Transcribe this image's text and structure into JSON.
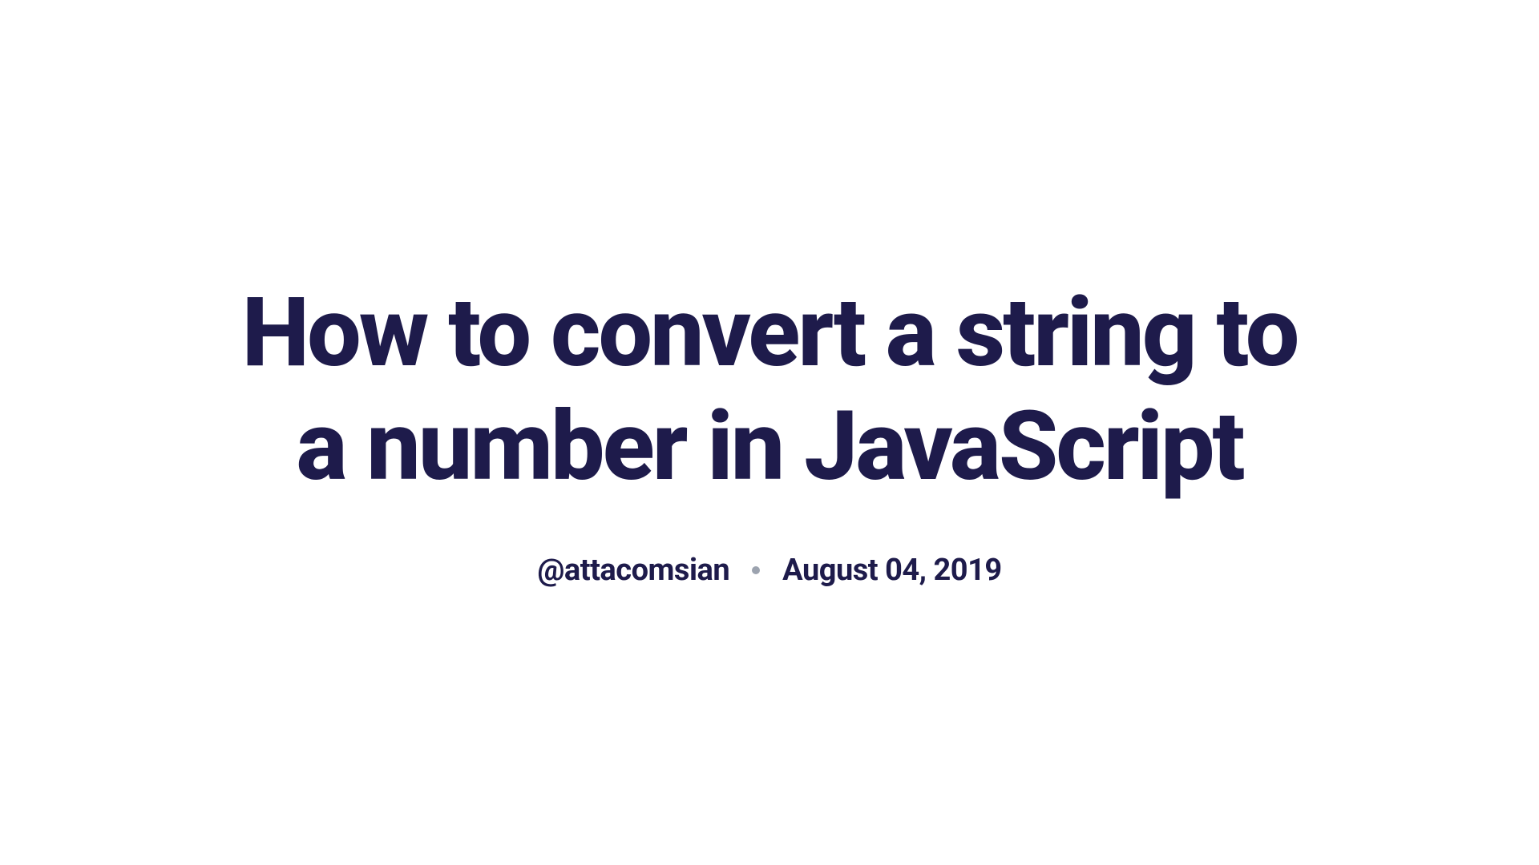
{
  "article": {
    "title": "How to convert a string to a number in JavaScript",
    "author": "@attacomsian",
    "date": "August 04, 2019"
  }
}
